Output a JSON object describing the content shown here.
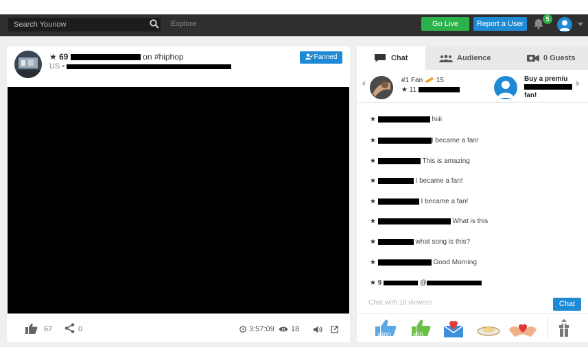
{
  "nav": {
    "search_placeholder": "Search Younow",
    "explore": "Explore",
    "go_live": "Go Live",
    "report": "Report a User",
    "notifications": "5"
  },
  "broadcast": {
    "level": "69",
    "tag_text": "on #hiphop",
    "location": "US •",
    "fan_status": "Fanned"
  },
  "stats": {
    "likes": "67",
    "shares": "0",
    "duration": "3:57:09",
    "viewers": "18"
  },
  "tabs": {
    "chat": "Chat",
    "audience": "Audience",
    "guests": "0 Guests"
  },
  "fans": {
    "top_rank": "#1 Fan",
    "top_count": "15",
    "top_level": "11",
    "premium_line1": "Buy a premiu",
    "premium_line3": "fan!"
  },
  "chat": {
    "messages": [
      {
        "text": "hiiii"
      },
      {
        "text": "I became a fan!"
      },
      {
        "text": "This is amazing"
      },
      {
        "text": "I became a fan!"
      },
      {
        "text": "I became a fan!"
      },
      {
        "text": "What is this"
      },
      {
        "text": "what song is this?"
      },
      {
        "text": "Good Morning"
      },
      {
        "level": "9",
        "text": "@"
      }
    ],
    "input_placeholder": "Chat with 18 viewers",
    "send": "Chat"
  },
  "gifts": {
    "thumbs_up": "x400",
    "green_thumb": "x50"
  },
  "colors": {
    "accent_blue": "#1e8ad6",
    "live_green": "#2db14a",
    "nav_dark": "#2f2f2f"
  }
}
